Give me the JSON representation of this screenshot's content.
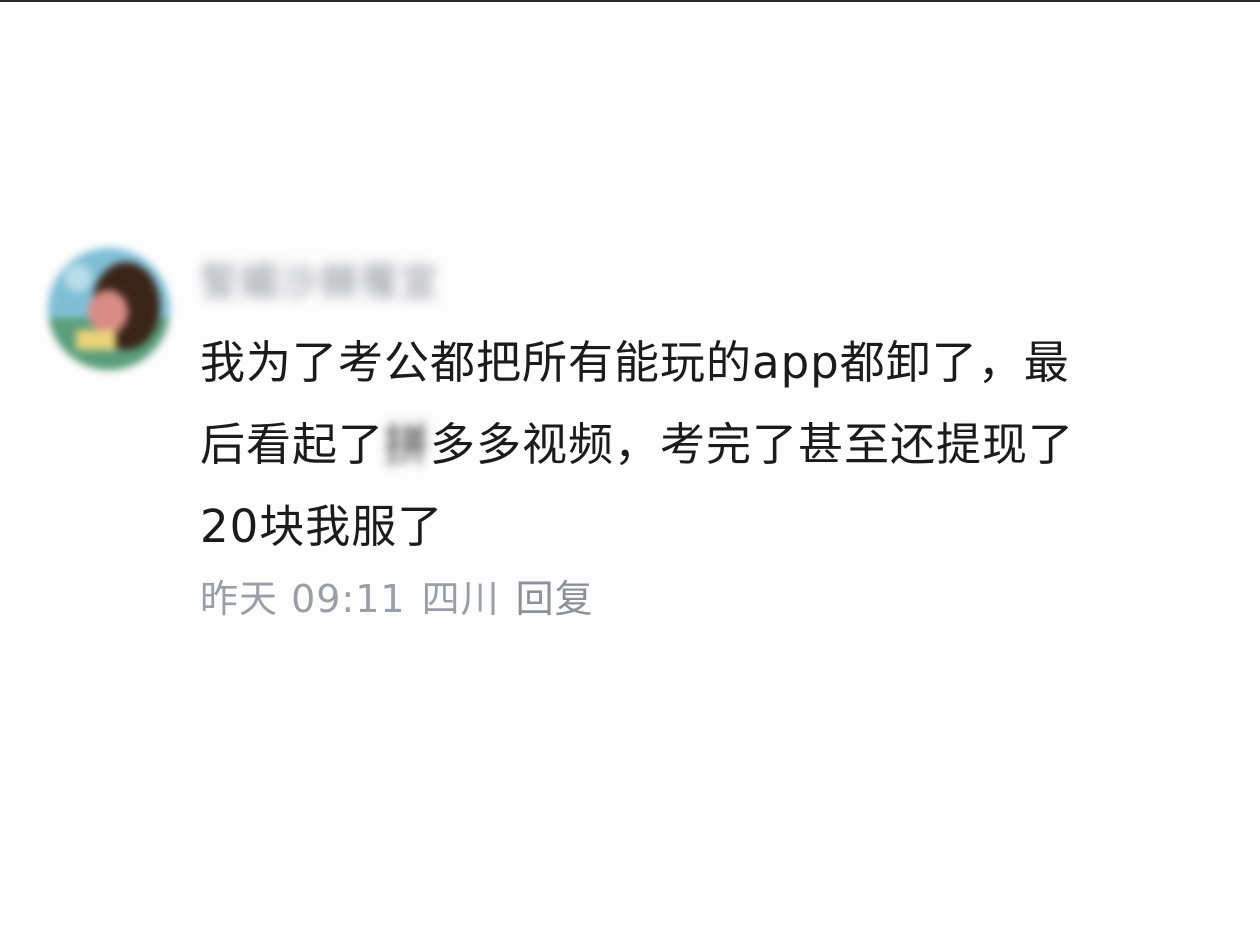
{
  "comment": {
    "username": "誓媚沙棘罹宜",
    "text_line1": "我为了考公都把所有能玩的app都卸了，最",
    "text_line2_before": "后看起了",
    "text_line2_blurred": "拼",
    "text_line2_after": "多多视频，考完了甚至还提现了",
    "text_line3": "20块我服了",
    "time": "昨天 09:11",
    "location": "四川",
    "reply_label": "回复"
  }
}
